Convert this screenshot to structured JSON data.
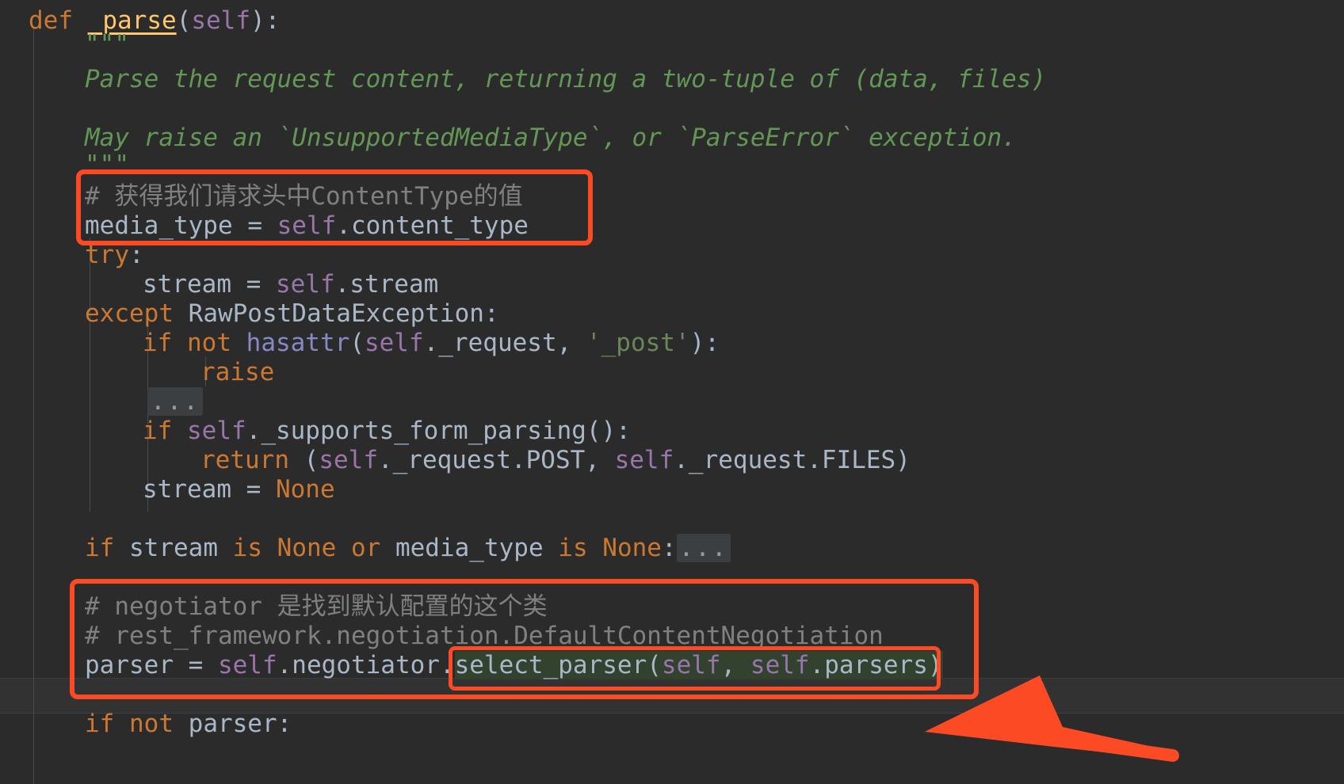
{
  "app": {
    "kind": "code-editor-screenshot",
    "theme": "darcula-dark",
    "language": "python"
  },
  "colors": {
    "background": "#2b2b2b",
    "default_text": "#a9b7c6",
    "keyword": "#cc7832",
    "function_name": "#ffc66d",
    "self_keyword": "#9876aa",
    "docstring": "#629755",
    "comment": "#808080",
    "string": "#6a8759",
    "annotation_orange": "#fc4b24",
    "selection_green": "#32422f",
    "fold_badge": "#3c3f41"
  },
  "code": {
    "lines": [
      {
        "n": 1,
        "indent": 0,
        "text": "def _parse(self):"
      },
      {
        "n": 2,
        "indent": 2,
        "text": "\"\"\""
      },
      {
        "n": 3,
        "indent": 2,
        "text": "Parse the request content, returning a two-tuple of (data, files)"
      },
      {
        "n": 4,
        "indent": 2,
        "text": ""
      },
      {
        "n": 5,
        "indent": 2,
        "text": "May raise an `UnsupportedMediaType`, or `ParseError` exception."
      },
      {
        "n": 6,
        "indent": 2,
        "text": "\"\"\""
      },
      {
        "n": 7,
        "indent": 2,
        "text": "# 获得我们请求头中ContentType的值"
      },
      {
        "n": 8,
        "indent": 2,
        "text": "media_type = self.content_type"
      },
      {
        "n": 9,
        "indent": 2,
        "text": "try:"
      },
      {
        "n": 10,
        "indent": 3,
        "text": "stream = self.stream"
      },
      {
        "n": 11,
        "indent": 2,
        "text": "except RawPostDataException:"
      },
      {
        "n": 12,
        "indent": 3,
        "text": "if not hasattr(self._request, '_post'):"
      },
      {
        "n": 13,
        "indent": 4,
        "text": "raise"
      },
      {
        "n": 14,
        "indent": 3,
        "text": "..."
      },
      {
        "n": 15,
        "indent": 3,
        "text": "if self._supports_form_parsing():"
      },
      {
        "n": 16,
        "indent": 4,
        "text": "return (self._request.POST, self._request.FILES)"
      },
      {
        "n": 17,
        "indent": 3,
        "text": "stream = None"
      },
      {
        "n": 18,
        "indent": 2,
        "text": ""
      },
      {
        "n": 19,
        "indent": 2,
        "text": "if stream is None or media_type is None:..."
      },
      {
        "n": 20,
        "indent": 2,
        "text": ""
      },
      {
        "n": 21,
        "indent": 2,
        "text": "# negotiator 是找到默认配置的这个类"
      },
      {
        "n": 22,
        "indent": 2,
        "text": "# rest_framework.negotiation.DefaultContentNegotiation"
      },
      {
        "n": 23,
        "indent": 2,
        "text": "parser = self.negotiator.select_parser(self, self.parsers)"
      },
      {
        "n": 24,
        "indent": 2,
        "text": ""
      },
      {
        "n": 25,
        "indent": 2,
        "text": "if not parser:"
      }
    ],
    "tokens": {
      "def_keyword": "def",
      "function_name": "_parse",
      "self_keyword": "self",
      "try_keyword": "try",
      "except_keyword": "except",
      "exception_class": "RawPostDataException",
      "if_keyword": "if",
      "not_keyword": "not",
      "or_keyword": "or",
      "is_keyword": "is",
      "return_keyword": "return",
      "raise_keyword": "raise",
      "none_keyword": "None",
      "hasattr_builtin": "hasattr",
      "post_string": "'_post'",
      "fold_ellipsis": "..."
    },
    "line1": {
      "def": "def",
      "name": "_parse",
      "open_paren": "(",
      "param": "self",
      "close_paren": ")",
      "colon": ":"
    },
    "docstring": {
      "open_quotes": "\"\"\"",
      "para1": "Parse the request content, returning a two-tuple of (data, files)",
      "para2": "May raise an `UnsupportedMediaType`, or `ParseError` exception.",
      "close_quotes": "\"\"\""
    },
    "comment_cn_1": "# 获得我们请求头中ContentType的值",
    "comment_cn_2": "# negotiator 是找到默认配置的这个类",
    "comment_path": "# rest_framework.negotiation.DefaultContentNegotiation",
    "stmt_media_type": {
      "lhs": "media_type ",
      "eq": "= ",
      "self": "self",
      "attr": ".content_type"
    },
    "stmt_try": {
      "kw": "try",
      "colon": ":"
    },
    "stmt_stream_assign": {
      "lhs": "stream ",
      "eq": "= ",
      "self": "self",
      "attr": ".stream"
    },
    "stmt_except": {
      "kw": "except ",
      "cls": "RawPostDataException",
      "colon": ":"
    },
    "stmt_if_hasattr": {
      "if": "if ",
      "not": "not ",
      "fn": "hasattr",
      "p1": "(",
      "self": "self",
      "attr": "._request, ",
      "str": "'_post'",
      "p2": "):"
    },
    "stmt_raise": "raise",
    "stmt_fold": "...",
    "stmt_if_supports": {
      "if": "if ",
      "self": "self",
      "rest": "._supports_form_parsing():"
    },
    "stmt_return": {
      "kw": "return ",
      "p1": "(",
      "self1": "self",
      "a1": "._request.POST, ",
      "self2": "self",
      "a2": "._request.FILES",
      "p2": ")"
    },
    "stmt_stream_none": {
      "lhs": "stream ",
      "eq": "= ",
      "none": "None"
    },
    "stmt_if_stream_none": {
      "if": "if ",
      "v1": "stream ",
      "is1": "is ",
      "n1": "None ",
      "or": "or ",
      "v2": "media_type ",
      "is2": "is ",
      "n2": "None",
      "colon": ":",
      "fold": "..."
    },
    "stmt_parser": {
      "lhs": "parser ",
      "eq": "= ",
      "self1": "self",
      "mid": ".negotiator.",
      "call": "select_parser",
      "p1": "(",
      "self2": "self",
      "comma": ", ",
      "self3": "self",
      "a3": ".parsers",
      "p2": ")"
    },
    "stmt_if_not_parser": {
      "if": "if ",
      "not": "not ",
      "v": "parser",
      "colon": ":"
    }
  },
  "annotations": {
    "boxes": [
      {
        "name": "highlight-box-media-type",
        "label": "Red rounded rectangle around the ContentType comment and media_type assignment"
      },
      {
        "name": "highlight-box-negotiator",
        "label": "Red rounded rectangle around the negotiator comments and parser assignment"
      },
      {
        "name": "highlight-box-select-parser",
        "label": "Inner red rounded rectangle around select_parser(self, self.parsers)"
      }
    ],
    "arrow": {
      "name": "pointer-arrow",
      "label": "Thick orange arrow pointing left at select_parser(self, self.parsers)",
      "color": "#fc4b24"
    }
  }
}
